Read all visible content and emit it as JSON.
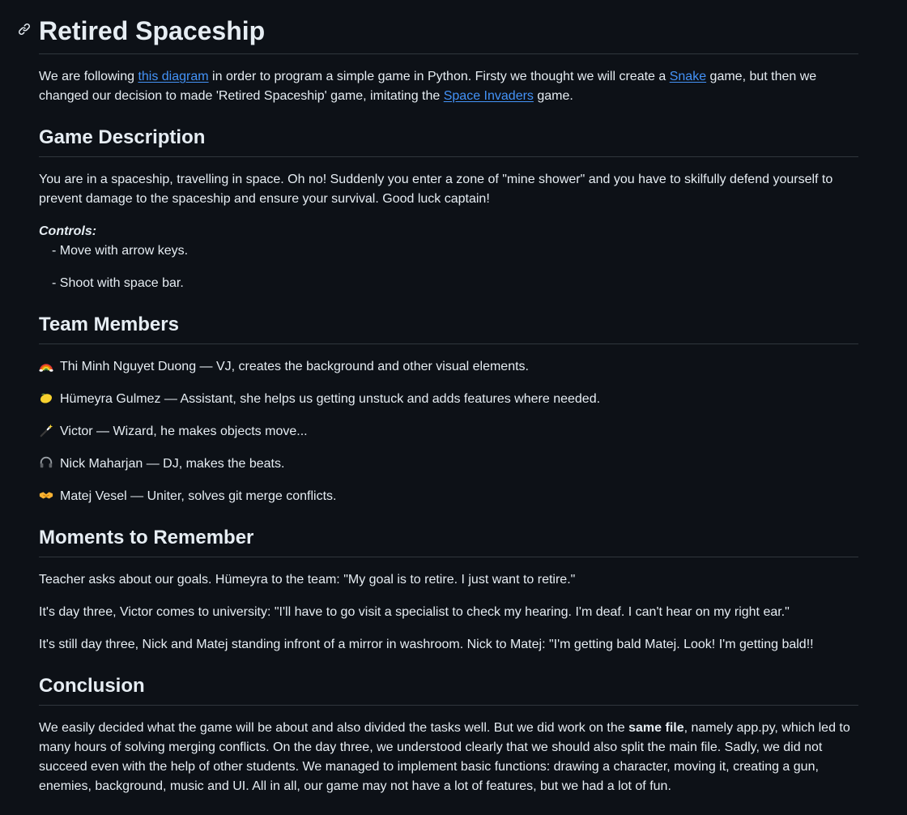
{
  "title": "Retired Spaceship",
  "intro": {
    "t1": "We are following ",
    "link_diagram": "this diagram",
    "t2": " in order to program a simple game in Python. Firsty we thought we will create a ",
    "link_snake": "Snake",
    "t3": " game, but then we changed our decision to made 'Retired Spaceship' game, imitating the ",
    "link_invaders": "Space Invaders",
    "t4": " game."
  },
  "game_description": {
    "heading": "Game Description",
    "text": "You are in a spaceship, travelling in space. Oh no! Suddenly you enter a zone of \"mine shower\" and you have to skilfully defend yourself to prevent damage to the spaceship and ensure your survival. Good luck captain!",
    "controls_label": "Controls:",
    "controls": [
      "- Move with arrow keys.",
      "- Shoot with space bar."
    ]
  },
  "team": {
    "heading": "Team Members",
    "members": [
      {
        "icon": "rainbow-icon",
        "text": "Thi Minh Nguyet Duong — VJ, creates the background and other visual elements."
      },
      {
        "icon": "lemon-icon",
        "text": "Hümeyra Gulmez — Assistant, she helps us getting unstuck and adds features where needed."
      },
      {
        "icon": "magic-wand-icon",
        "text": "Victor — Wizard, he makes objects move..."
      },
      {
        "icon": "headphones-icon",
        "text": "Nick Maharjan — DJ, makes the beats."
      },
      {
        "icon": "handshake-icon",
        "text": "Matej Vesel — Uniter, solves git merge conflicts."
      }
    ]
  },
  "moments": {
    "heading": "Moments to Remember",
    "items": [
      "Teacher asks about our goals. Hümeyra to the team: \"My goal is to retire. I just want to retire.\"",
      "It's day three, Victor comes to university: \"I'll have to go visit a specialist to check my hearing. I'm deaf. I can't hear on my right ear.\"",
      "It's still day three, Nick and Matej standing infront of a mirror in washroom. Nick to Matej: \"I'm getting bald Matej. Look! I'm getting bald!!"
    ]
  },
  "conclusion": {
    "heading": "Conclusion",
    "t1": "We easily decided what the game will be about and also divided the tasks well. But we did work on the ",
    "bold": "same file",
    "t2": ", namely app.py, which led to many hours of solving merging conflicts. On the day three, we understood clearly that we should also split the main file. Sadly, we did not succeed even with the help of other students. We managed to implement basic functions: drawing a character, moving it, creating a gun, enemies, background, music and UI. All in all, our game may not have a lot of features, but we had a lot of fun."
  },
  "colors": {
    "background": "#0d1117",
    "text": "#e6edf3",
    "link": "#4493f8",
    "divider": "#30363d"
  }
}
